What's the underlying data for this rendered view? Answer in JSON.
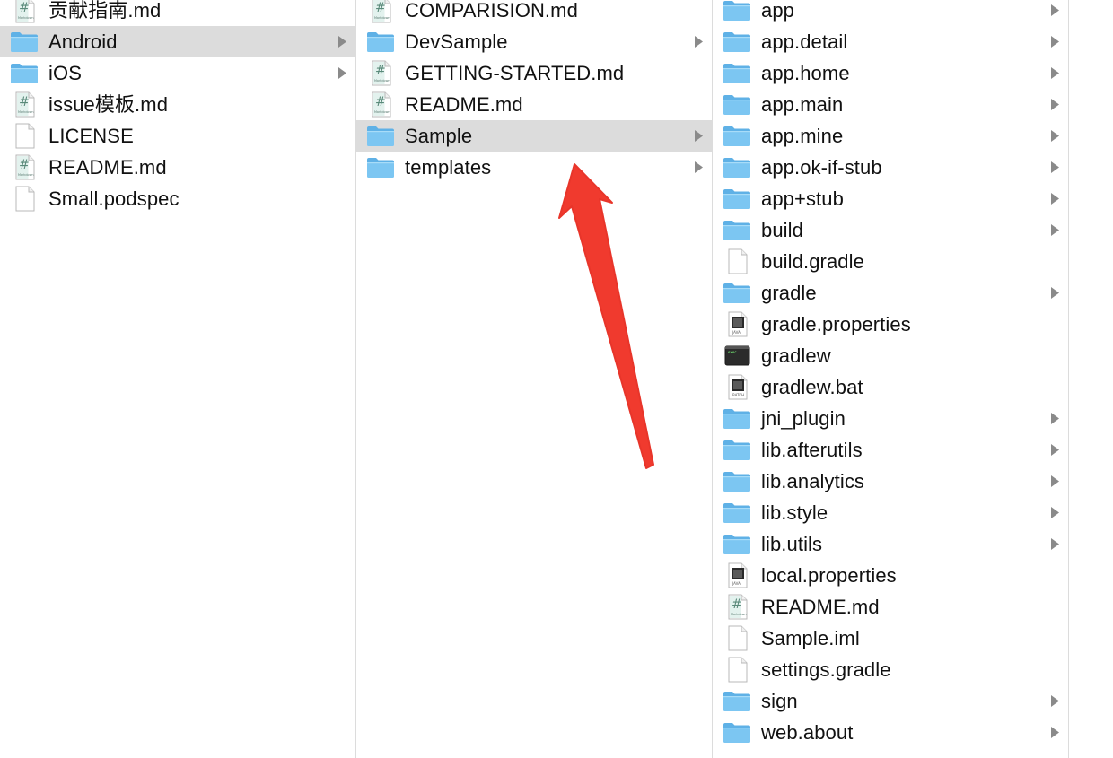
{
  "columns": [
    {
      "items": [
        {
          "name": "贡献指南.md",
          "icon": "markdown-file",
          "folder": false,
          "selected": false
        },
        {
          "name": "Android",
          "icon": "folder",
          "folder": true,
          "selected": true
        },
        {
          "name": "iOS",
          "icon": "folder",
          "folder": true,
          "selected": false
        },
        {
          "name": "issue模板.md",
          "icon": "markdown-file",
          "folder": false,
          "selected": false
        },
        {
          "name": "LICENSE",
          "icon": "blank-file",
          "folder": false,
          "selected": false
        },
        {
          "name": "README.md",
          "icon": "markdown-file",
          "folder": false,
          "selected": false
        },
        {
          "name": "Small.podspec",
          "icon": "blank-file",
          "folder": false,
          "selected": false
        }
      ]
    },
    {
      "items": [
        {
          "name": "COMPARISION.md",
          "icon": "markdown-file",
          "folder": false,
          "selected": false
        },
        {
          "name": "DevSample",
          "icon": "folder",
          "folder": true,
          "selected": false
        },
        {
          "name": "GETTING-STARTED.md",
          "icon": "markdown-file",
          "folder": false,
          "selected": false
        },
        {
          "name": "README.md",
          "icon": "markdown-file",
          "folder": false,
          "selected": false
        },
        {
          "name": "Sample",
          "icon": "folder",
          "folder": true,
          "selected": true
        },
        {
          "name": "templates",
          "icon": "folder",
          "folder": true,
          "selected": false
        }
      ]
    },
    {
      "items": [
        {
          "name": "app",
          "icon": "folder",
          "folder": true,
          "selected": false
        },
        {
          "name": "app.detail",
          "icon": "folder",
          "folder": true,
          "selected": false
        },
        {
          "name": "app.home",
          "icon": "folder",
          "folder": true,
          "selected": false
        },
        {
          "name": "app.main",
          "icon": "folder",
          "folder": true,
          "selected": false
        },
        {
          "name": "app.mine",
          "icon": "folder",
          "folder": true,
          "selected": false
        },
        {
          "name": "app.ok-if-stub",
          "icon": "folder",
          "folder": true,
          "selected": false
        },
        {
          "name": "app+stub",
          "icon": "folder",
          "folder": true,
          "selected": false
        },
        {
          "name": "build",
          "icon": "folder",
          "folder": true,
          "selected": false
        },
        {
          "name": "build.gradle",
          "icon": "blank-file",
          "folder": false,
          "selected": false
        },
        {
          "name": "gradle",
          "icon": "folder",
          "folder": true,
          "selected": false
        },
        {
          "name": "gradle.properties",
          "icon": "java-file",
          "folder": false,
          "selected": false
        },
        {
          "name": "gradlew",
          "icon": "terminal-exec",
          "folder": false,
          "selected": false
        },
        {
          "name": "gradlew.bat",
          "icon": "batch-file",
          "folder": false,
          "selected": false
        },
        {
          "name": "jni_plugin",
          "icon": "folder",
          "folder": true,
          "selected": false
        },
        {
          "name": "lib.afterutils",
          "icon": "folder",
          "folder": true,
          "selected": false
        },
        {
          "name": "lib.analytics",
          "icon": "folder",
          "folder": true,
          "selected": false
        },
        {
          "name": "lib.style",
          "icon": "folder",
          "folder": true,
          "selected": false
        },
        {
          "name": "lib.utils",
          "icon": "folder",
          "folder": true,
          "selected": false
        },
        {
          "name": "local.properties",
          "icon": "java-file",
          "folder": false,
          "selected": false
        },
        {
          "name": "README.md",
          "icon": "markdown-file",
          "folder": false,
          "selected": false
        },
        {
          "name": "Sample.iml",
          "icon": "blank-file",
          "folder": false,
          "selected": false
        },
        {
          "name": "settings.gradle",
          "icon": "blank-file",
          "folder": false,
          "selected": false
        },
        {
          "name": "sign",
          "icon": "folder",
          "folder": true,
          "selected": false
        },
        {
          "name": "web.about",
          "icon": "folder",
          "folder": true,
          "selected": false
        }
      ]
    }
  ],
  "icon_text": {
    "hash": "#",
    "markdown_caption": "Markdown",
    "java_caption": "JAVA",
    "batch_caption": "BATCH",
    "exec_caption": "exec"
  },
  "colors": {
    "selected_row": "#dcdcdc",
    "folder_front": "#7cc6f2",
    "folder_back": "#5fb1e6",
    "annotation_arrow": "#f03a2e",
    "chevron": "#8a8a8a"
  }
}
